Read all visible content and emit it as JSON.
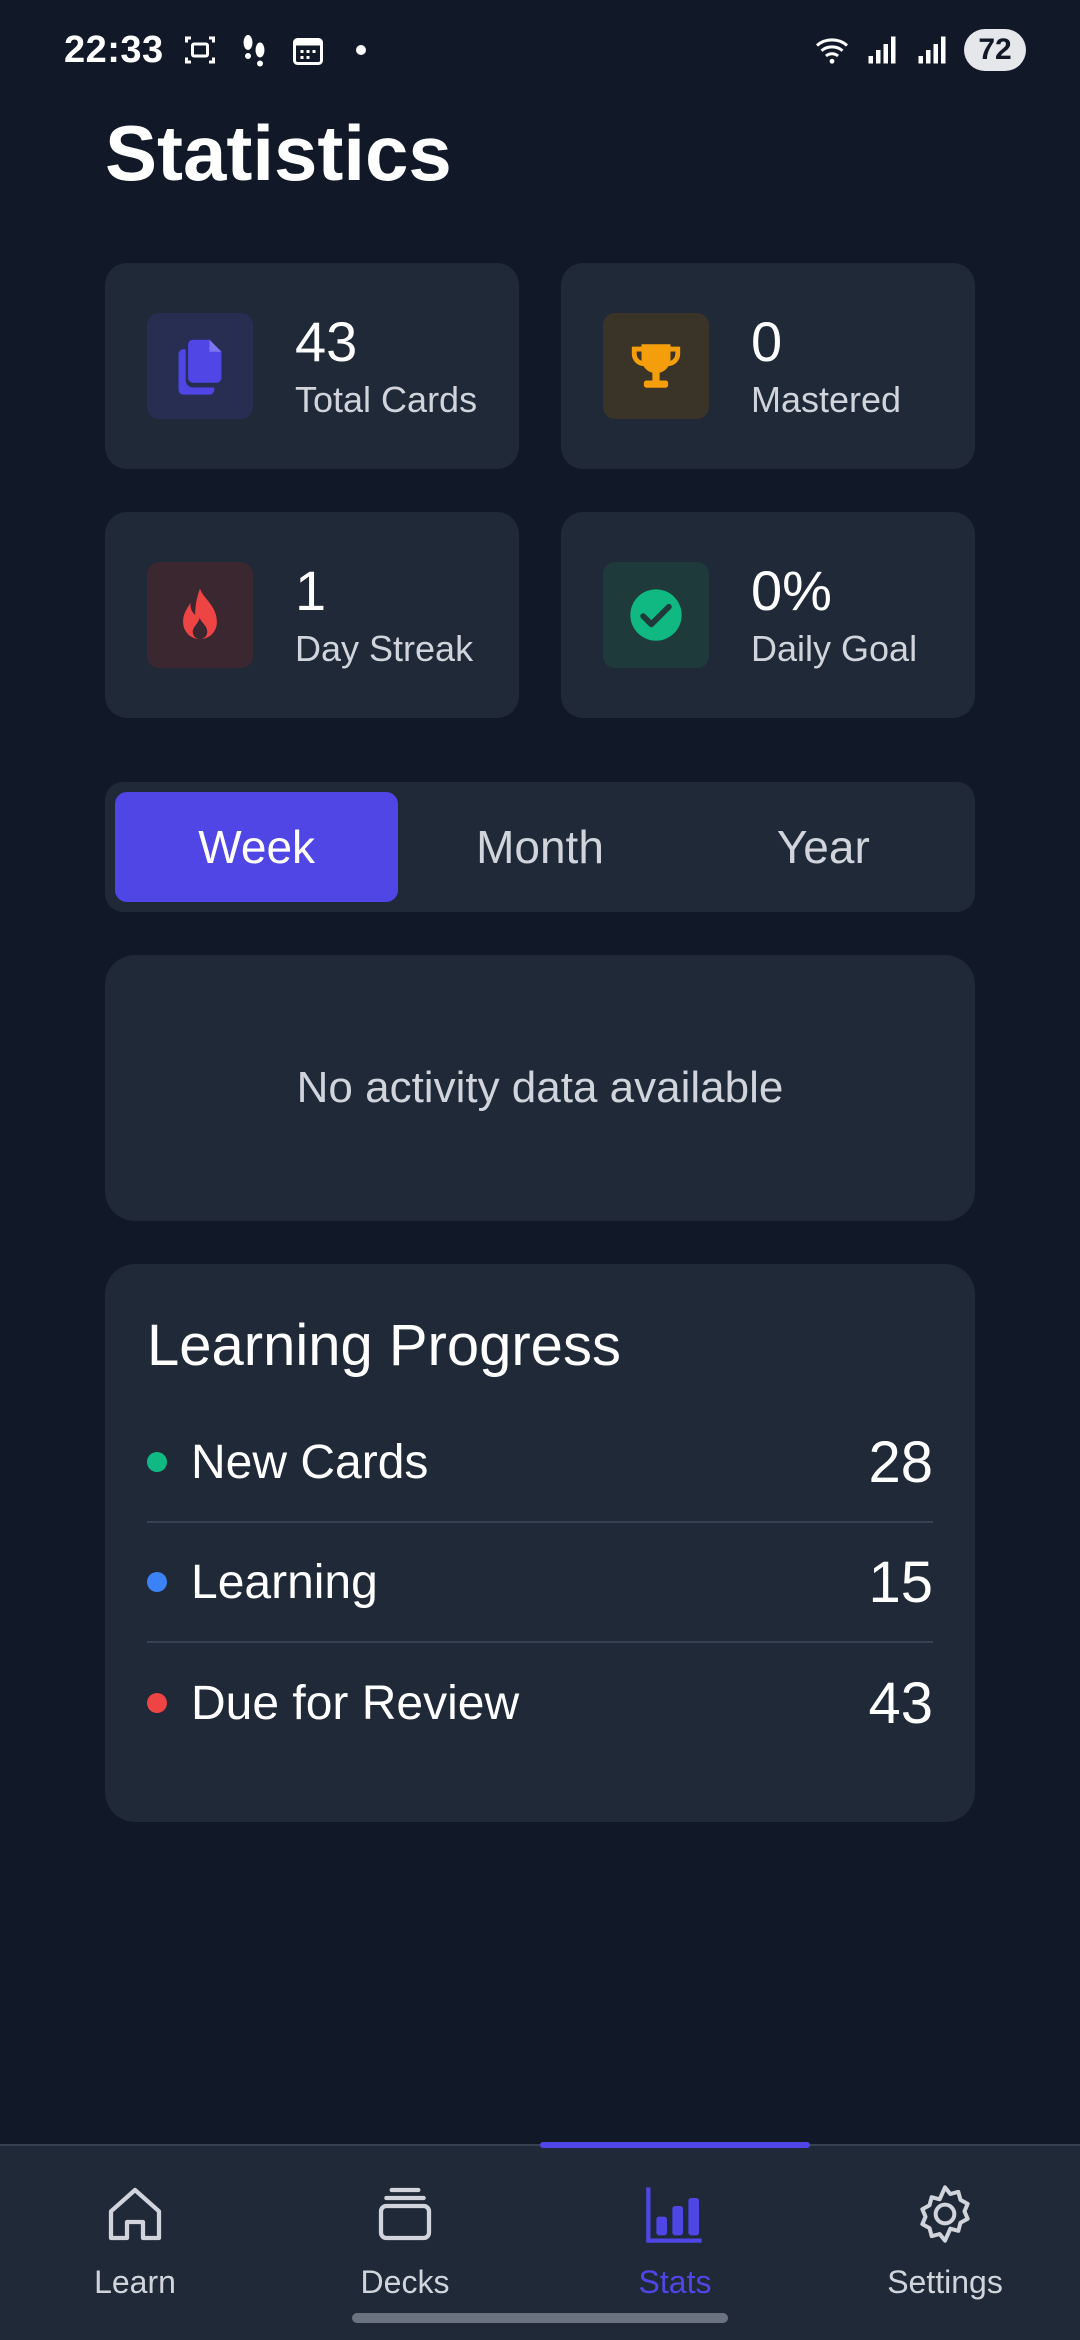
{
  "status_bar": {
    "time": "22:33",
    "battery": "72",
    "icons": [
      "screenshot-icon",
      "steps-icon",
      "calendar-icon",
      "wifi-icon",
      "signal-icon",
      "signal-icon"
    ]
  },
  "page": {
    "title": "Statistics"
  },
  "stats": {
    "total_cards": {
      "value": "43",
      "label": "Total Cards",
      "icon": "cards-icon",
      "color": "#4f46e5"
    },
    "mastered": {
      "value": "0",
      "label": "Mastered",
      "icon": "trophy-icon",
      "color": "#f59e0b"
    },
    "day_streak": {
      "value": "1",
      "label": "Day Streak",
      "icon": "flame-icon",
      "color": "#ef4444"
    },
    "daily_goal": {
      "value": "0%",
      "label": "Daily Goal",
      "icon": "check-circle-icon",
      "color": "#10b981"
    }
  },
  "period_tabs": {
    "selected": "Week",
    "items": [
      {
        "label": "Week"
      },
      {
        "label": "Month"
      },
      {
        "label": "Year"
      }
    ]
  },
  "activity": {
    "empty_text": "No activity data available"
  },
  "learning_progress": {
    "title": "Learning Progress",
    "rows": [
      {
        "label": "New Cards",
        "value": "28",
        "color": "#10b981"
      },
      {
        "label": "Learning",
        "value": "15",
        "color": "#3b82f6"
      },
      {
        "label": "Due for Review",
        "value": "43",
        "color": "#ef4444"
      }
    ]
  },
  "bottom_nav": {
    "active": "Stats",
    "items": [
      {
        "label": "Learn",
        "icon": "home-icon"
      },
      {
        "label": "Decks",
        "icon": "decks-icon"
      },
      {
        "label": "Stats",
        "icon": "bar-chart-icon"
      },
      {
        "label": "Settings",
        "icon": "gear-icon"
      }
    ]
  },
  "colors": {
    "background": "#111827",
    "card": "#1f2937",
    "accent": "#4f46e5"
  }
}
